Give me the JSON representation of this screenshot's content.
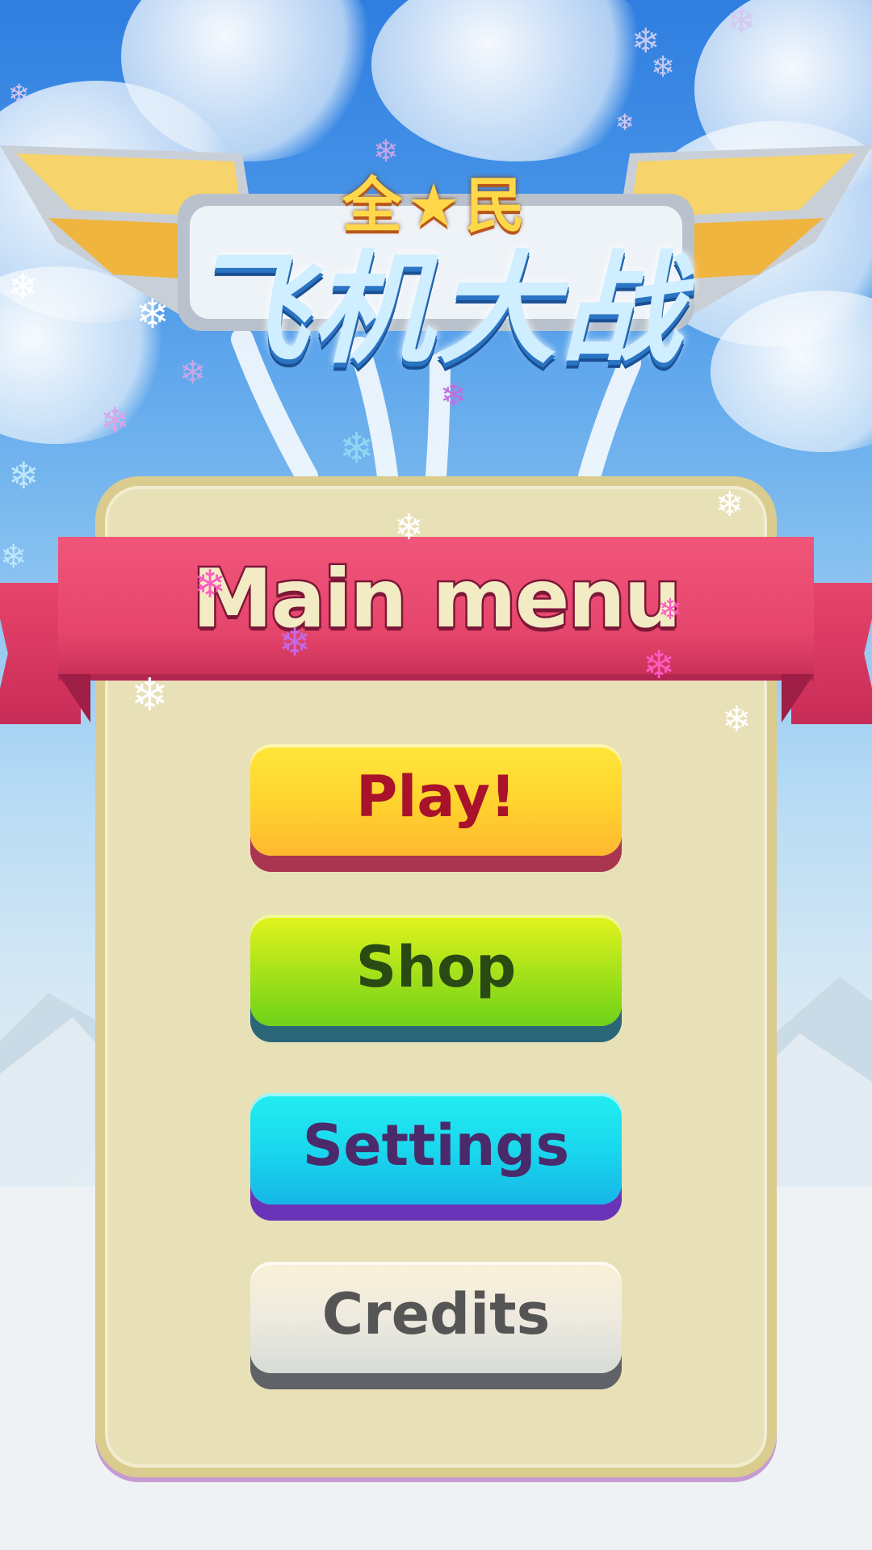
{
  "game": {
    "logo_line1": "全★民",
    "logo_line2": "飞机大战"
  },
  "menu": {
    "title": "Main menu",
    "buttons": {
      "play": "Play!",
      "shop": "Shop",
      "settings": "Settings",
      "credits": "Credits"
    }
  },
  "colors": {
    "sky_top": "#2f7ee0",
    "panel": "#e8e0b6",
    "ribbon": "#e6456c",
    "play_button": "#ffd22e",
    "shop_button": "#a8e21a",
    "settings_button": "#1ad8ee",
    "credits_button": "#eeeadf"
  },
  "decorations": {
    "snowflake_icon": "❄"
  }
}
